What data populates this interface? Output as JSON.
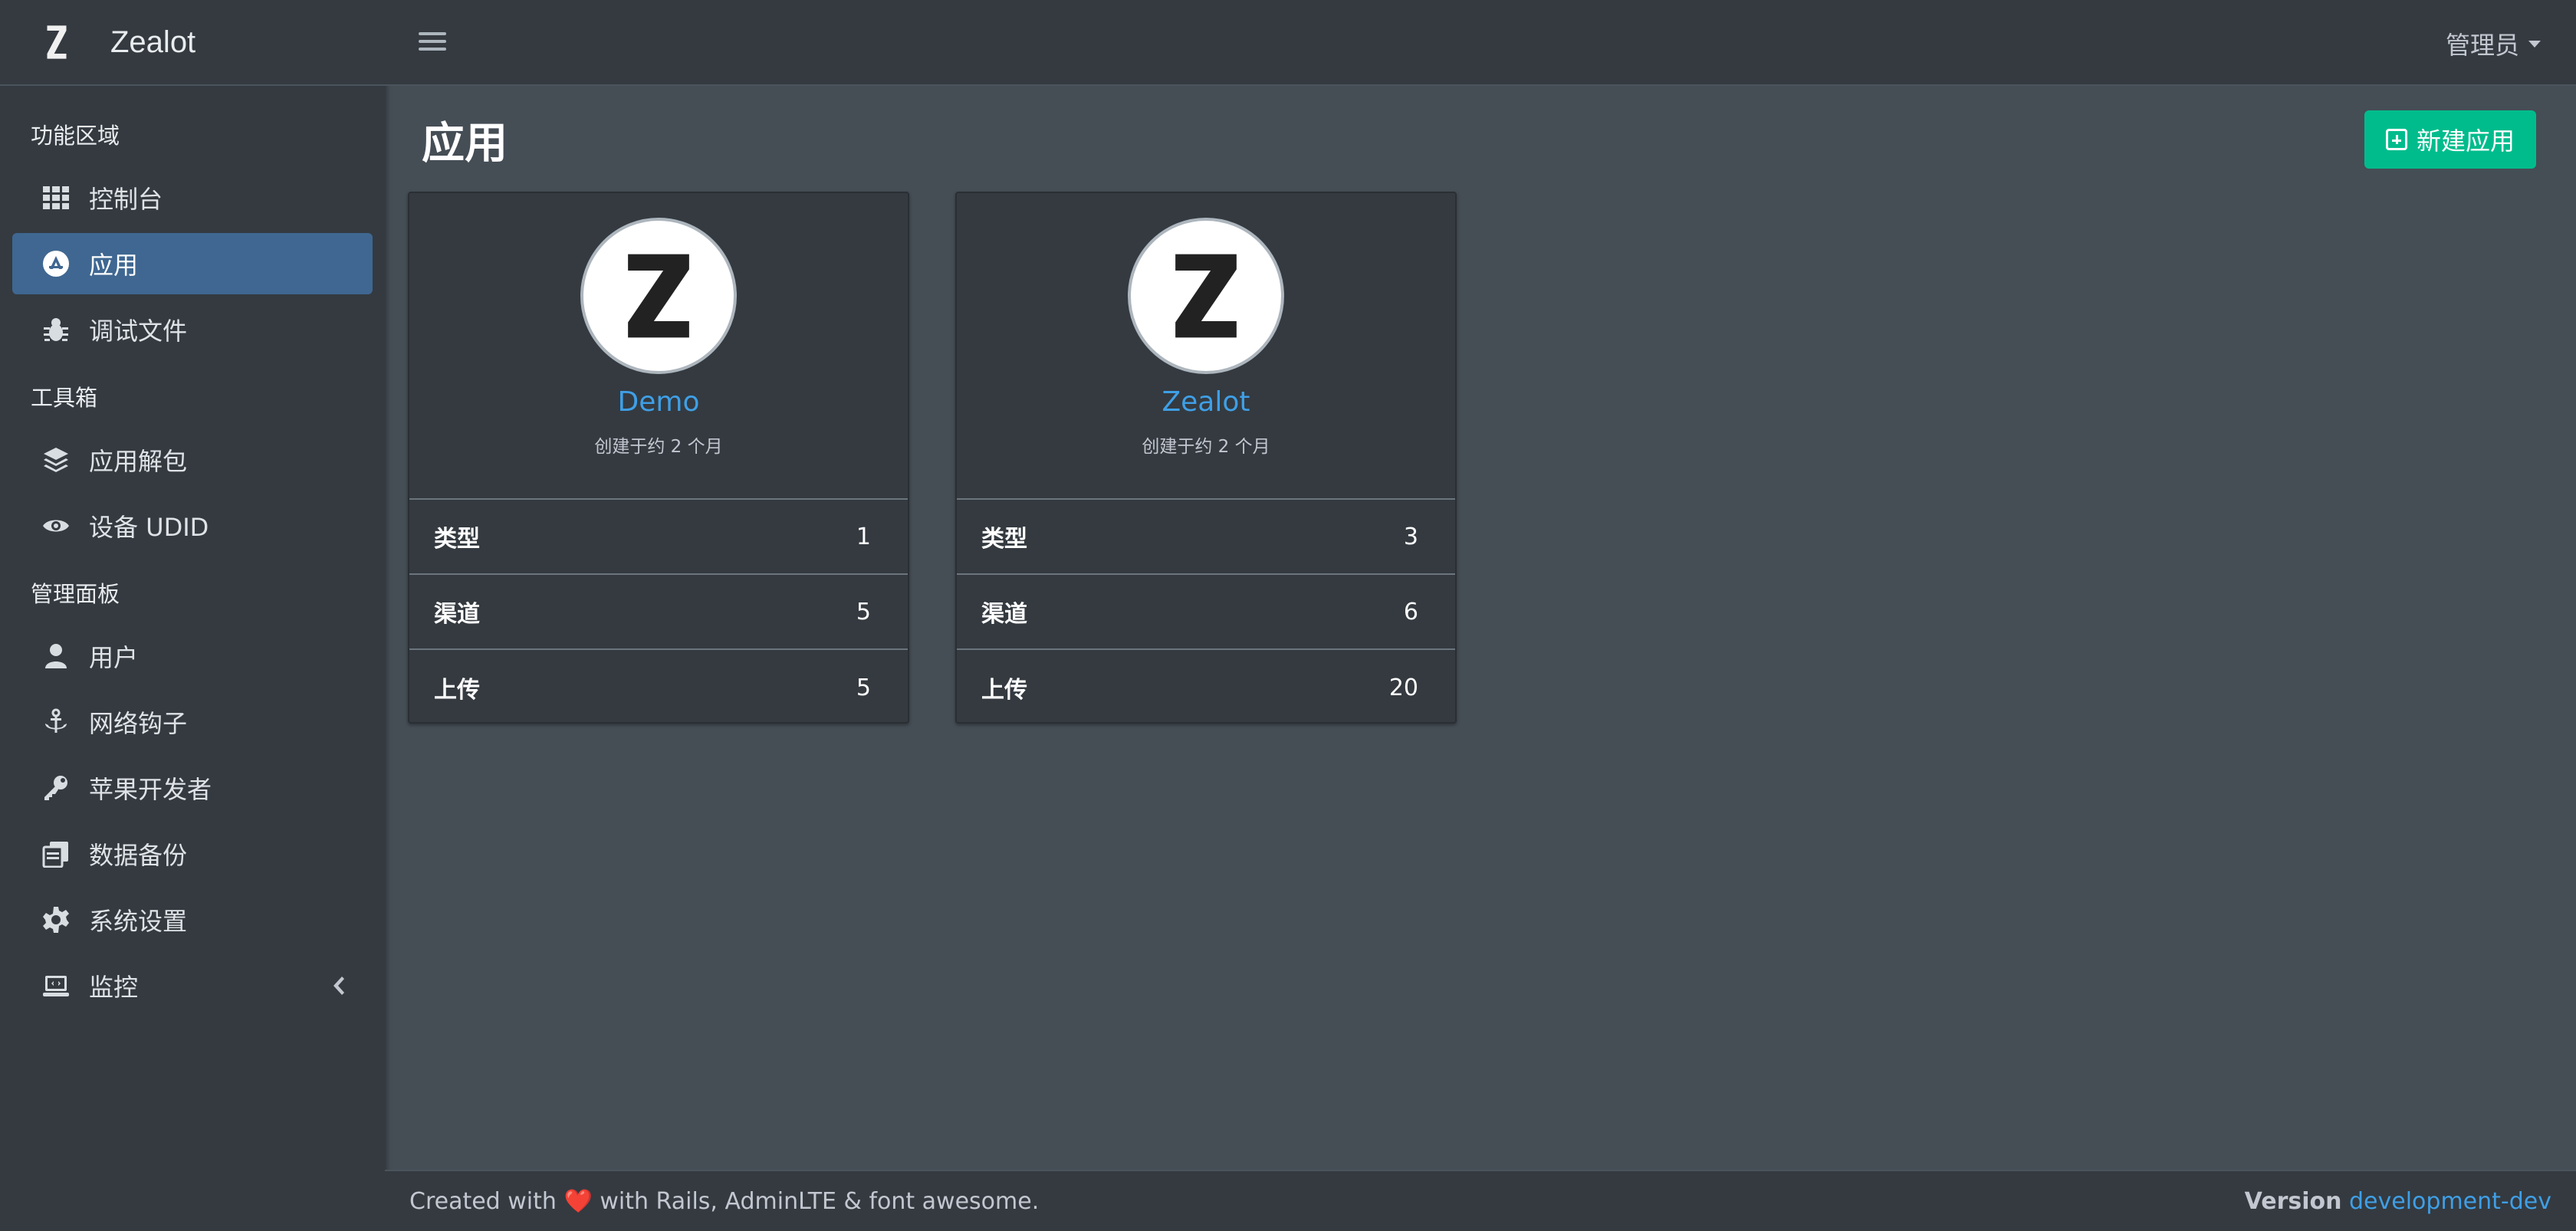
{
  "brand": {
    "name": "Zealot"
  },
  "sidebar": {
    "sections": [
      {
        "header": "功能区域",
        "items": [
          {
            "label": "控制台",
            "icon": "grid-icon"
          },
          {
            "label": "应用",
            "icon": "app-store-icon",
            "active": true
          },
          {
            "label": "调试文件",
            "icon": "bug-icon"
          }
        ]
      },
      {
        "header": "工具箱",
        "items": [
          {
            "label": "应用解包",
            "icon": "layers-icon"
          },
          {
            "label": "设备 UDID",
            "icon": "eye-icon"
          }
        ]
      },
      {
        "header": "管理面板",
        "items": [
          {
            "label": "用户",
            "icon": "user-icon"
          },
          {
            "label": "网络钩子",
            "icon": "anchor-icon"
          },
          {
            "label": "苹果开发者",
            "icon": "key-icon"
          },
          {
            "label": "数据备份",
            "icon": "copy-icon"
          },
          {
            "label": "系统设置",
            "icon": "gear-icon"
          },
          {
            "label": "监控",
            "icon": "laptop-code-icon",
            "has_children": true
          }
        ]
      }
    ]
  },
  "topbar": {
    "user": "管理员"
  },
  "page": {
    "title": "应用",
    "new_button": "新建应用"
  },
  "apps": [
    {
      "name": "Demo",
      "created": "创建于约 2 个月",
      "stats": [
        {
          "label": "类型",
          "value": "1"
        },
        {
          "label": "渠道",
          "value": "5"
        },
        {
          "label": "上传",
          "value": "5"
        }
      ]
    },
    {
      "name": "Zealot",
      "created": "创建于约 2 个月",
      "stats": [
        {
          "label": "类型",
          "value": "3"
        },
        {
          "label": "渠道",
          "value": "6"
        },
        {
          "label": "上传",
          "value": "20"
        }
      ]
    }
  ],
  "footer": {
    "created_prefix": "Created with",
    "heart": "❤️",
    "created_suffix": "with Rails, AdminLTE & font awesome.",
    "version_label": "Version",
    "version_value": "development-dev"
  },
  "colors": {
    "accent": "#3f6791",
    "success": "#00bc8c",
    "link": "#3f9fe6"
  }
}
